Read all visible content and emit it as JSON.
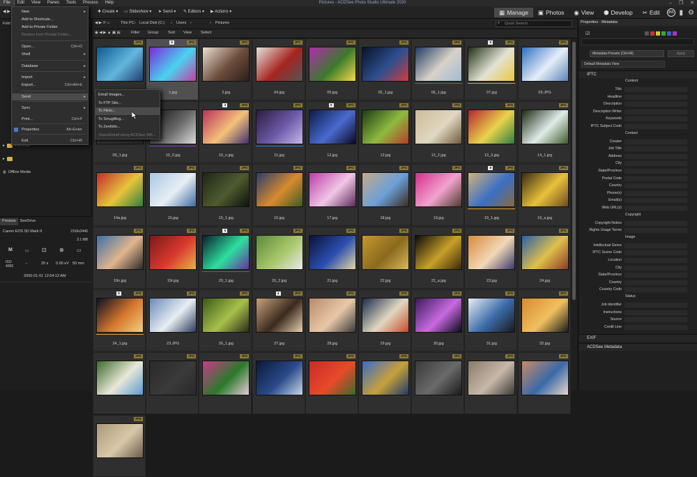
{
  "window": {
    "title": "Pictures - ACDSee Photo Studio Ultimate 2020",
    "controls": [
      "–",
      "❐",
      "✕"
    ]
  },
  "menubar": [
    "File",
    "Edit",
    "View",
    "Panes",
    "Tools",
    "Process",
    "Help"
  ],
  "toolbar": {
    "create": "Create",
    "slideshow": "Slideshow",
    "send": "Send",
    "editors": "Editors",
    "actions": "Actions"
  },
  "modes": {
    "manage": "Manage",
    "photos": "Photos",
    "view": "View",
    "develop": "Develop",
    "edit": "Edit",
    "badge": "365"
  },
  "file_menu": {
    "items": [
      {
        "label": "New",
        "shortcut": "",
        "arrow": "▸",
        "disabled": false
      },
      {
        "label": "Add to Shortcuts...",
        "shortcut": "",
        "arrow": "",
        "disabled": false
      },
      {
        "label": "Add to Private Folder",
        "shortcut": "",
        "arrow": "",
        "disabled": false
      },
      {
        "label": "Restore from Private Folder...",
        "shortcut": "",
        "arrow": "",
        "disabled": true
      },
      {
        "label": "Open...",
        "shortcut": "Ctrl+O",
        "arrow": "",
        "disabled": false
      },
      {
        "label": "Shell",
        "shortcut": "",
        "arrow": "▸",
        "disabled": false
      },
      {
        "label": "Database",
        "shortcut": "",
        "arrow": "▸",
        "disabled": false
      },
      {
        "label": "Import",
        "shortcut": "",
        "arrow": "▸",
        "disabled": false
      },
      {
        "label": "Export...",
        "shortcut": "Ctrl+Alt+E",
        "arrow": "",
        "disabled": false
      },
      {
        "label": "Send",
        "shortcut": "",
        "arrow": "▸",
        "disabled": false
      },
      {
        "label": "Sync",
        "shortcut": "",
        "arrow": "▸",
        "disabled": false
      },
      {
        "label": "Print...",
        "shortcut": "Ctrl+P",
        "arrow": "",
        "disabled": false
      },
      {
        "label": "Properties",
        "shortcut": "Alt+Enter",
        "arrow": "",
        "disabled": false
      },
      {
        "label": "Exit",
        "shortcut": "Ctrl+W",
        "arrow": "",
        "disabled": false
      }
    ]
  },
  "send_menu": {
    "items": [
      {
        "label": "Email Images...",
        "disabled": false
      },
      {
        "label": "To FTP Site...",
        "disabled": false
      },
      {
        "label": "To Flickr...",
        "disabled": false
      },
      {
        "label": "To SmugMug...",
        "disabled": false
      },
      {
        "label": "To Zenfolio...",
        "disabled": false
      },
      {
        "label": "Share/Email using ACDSee 365...",
        "disabled": true
      }
    ]
  },
  "tree": {
    "partial_label": "Fold",
    "favorites": "Favorites",
    "offline_media": "Offline Media"
  },
  "breadcrumb": [
    "This PC",
    "Local Disk (C:)",
    "Users",
    "Pictures"
  ],
  "quick_search": {
    "placeholder": "Quick Search"
  },
  "filterbar": [
    "Filter",
    "Group",
    "Sort",
    "View",
    "Select"
  ],
  "preview": {
    "tabs": [
      "Preview",
      "SeeDrive"
    ],
    "camera": "Canon EOS 5D Mark II",
    "dimensions": "2156x2446",
    "size": "3.1 MB",
    "mode": "M",
    "iso_label": "ISO",
    "iso_value": "4000",
    "dash1": "--",
    "shutter": "25 s",
    "ev": "0.00 eV",
    "focal": "50 mm",
    "datetime": "2000-01-01 12:54:12 AM"
  },
  "thumbnails": [
    {
      "name": "",
      "badge": "JPG",
      "num": "",
      "bar": "",
      "c": [
        "#0c5a8f",
        "#63b7de",
        "#1e3f6d"
      ]
    },
    {
      "name": "1.jpg",
      "badge": "JPG",
      "num": "5",
      "bar": "",
      "c": [
        "#7b2ad6",
        "#4ad3f0",
        "#c53ca2"
      ]
    },
    {
      "name": "2.jpg",
      "badge": "JPG",
      "num": "",
      "bar": "",
      "c": [
        "#eadfd1",
        "#6d4c3b",
        "#2b1f1a"
      ]
    },
    {
      "name": "04.jpg",
      "badge": "JPG",
      "num": "",
      "bar": "",
      "c": [
        "#e7e3dd",
        "#a5241e",
        "#555"
      ]
    },
    {
      "name": "05.jpg",
      "badge": "JPG",
      "num": "",
      "bar": "",
      "c": [
        "#b22bb0",
        "#3b7a2b",
        "#f6d94b"
      ]
    },
    {
      "name": "05_1.jpg",
      "badge": "JPG",
      "num": "",
      "bar": "",
      "c": [
        "#08142a",
        "#2f4f8f",
        "#d23a3a"
      ]
    },
    {
      "name": "06_1.jpg",
      "badge": "JPG",
      "num": "",
      "bar": "#1e8f4d",
      "c": [
        "#203a63",
        "#d8d2c8",
        "#9fbad6"
      ]
    },
    {
      "name": "07.jpg",
      "badge": "JPG",
      "num": "5",
      "bar": "#e0a42a",
      "c": [
        "#213018",
        "#e3e2d4",
        "#e9c840"
      ]
    },
    {
      "name": "09.JPG",
      "badge": "JPG",
      "num": "",
      "bar": "",
      "c": [
        "#2b6fc4",
        "#e6eef7",
        "#5b86b8"
      ]
    },
    {
      "name": "09_1.jpg",
      "badge": "JPG",
      "num": "",
      "bar": "",
      "c": [
        "#2f2f2f",
        "#3a3a3a",
        "#2f2f2f"
      ]
    },
    {
      "name": "10_0.jpg",
      "badge": "",
      "num": "",
      "bar": "#8a3dbf",
      "c": [
        "#0e0e0e",
        "#6a6a6a",
        "#dcdcdc"
      ]
    },
    {
      "name": "10_n.jpg",
      "badge": "JPG",
      "num": "4",
      "bar": "",
      "c": [
        "#b82f5a",
        "#f3c27a",
        "#3d2f6f"
      ]
    },
    {
      "name": "11.jpg",
      "badge": "JPG",
      "num": "",
      "bar": "#2c7dd0",
      "c": [
        "#2b1b3f",
        "#6c5aa8",
        "#c6b7e8"
      ]
    },
    {
      "name": "12.jpg",
      "badge": "JPG",
      "num": "5",
      "bar": "",
      "c": [
        "#0b1b45",
        "#4a6ad0",
        "#0a0a20"
      ]
    },
    {
      "name": "13.jpg",
      "badge": "JPG",
      "num": "",
      "bar": "",
      "c": [
        "#1f3a14",
        "#8dbb3e",
        "#b73a2a"
      ]
    },
    {
      "name": "13_2.jpg",
      "badge": "JPG",
      "num": "",
      "bar": "",
      "c": [
        "#cdbb97",
        "#e0d8c2",
        "#6f5a3b"
      ]
    },
    {
      "name": "13_3.jpg",
      "badge": "JPG",
      "num": "",
      "bar": "",
      "c": [
        "#b32530",
        "#e9d34b",
        "#2e7d43"
      ]
    },
    {
      "name": "14_1.jpg",
      "badge": "JPG",
      "num": "",
      "bar": "",
      "c": [
        "#1c2a16",
        "#e0ece8",
        "#3e5b2a"
      ]
    },
    {
      "name": "14a.jpg",
      "badge": "JPG",
      "num": "",
      "bar": "",
      "c": [
        "#c22b2b",
        "#e8c43b",
        "#2d7d3d"
      ]
    },
    {
      "name": "15.jpg",
      "badge": "JPG",
      "num": "",
      "bar": "",
      "c": [
        "#a9c8e6",
        "#e8eef4",
        "#3c6b9e"
      ]
    },
    {
      "name": "15_1.jpg",
      "badge": "JPG",
      "num": "",
      "bar": "",
      "c": [
        "#1c2617",
        "#4f5b2f",
        "#0e120c"
      ]
    },
    {
      "name": "16.jpg",
      "badge": "JPG",
      "num": "",
      "bar": "",
      "c": [
        "#2a3c6a",
        "#d88a2f",
        "#3d5a22"
      ]
    },
    {
      "name": "17.jpg",
      "badge": "JPG",
      "num": "",
      "bar": "",
      "c": [
        "#b83ea6",
        "#f0c6e6",
        "#5e2a5a"
      ]
    },
    {
      "name": "18.jpg",
      "badge": "JPG",
      "num": "",
      "bar": "",
      "c": [
        "#c7a98a",
        "#6aa0d8",
        "#3c2a1e"
      ]
    },
    {
      "name": "19.jpg",
      "badge": "JPG",
      "num": "",
      "bar": "",
      "c": [
        "#d32e8a",
        "#f2a3cf",
        "#4c3b2a"
      ]
    },
    {
      "name": "19_1.jpg",
      "badge": "JPG",
      "num": "5",
      "bar": "#e0a42a",
      "c": [
        "#d2b27e",
        "#3a6fc4",
        "#8a6a3e"
      ]
    },
    {
      "name": "19_a.jpg",
      "badge": "JPG",
      "num": "",
      "bar": "",
      "c": [
        "#3a2a14",
        "#e8c23a",
        "#6b4a22"
      ]
    },
    {
      "name": "19n.jpg",
      "badge": "JPG",
      "num": "",
      "bar": "",
      "c": [
        "#3c6ea8",
        "#e1b58c",
        "#2a2a2a"
      ]
    },
    {
      "name": "19r.jpg",
      "badge": "JPG",
      "num": "",
      "bar": "",
      "c": [
        "#7a1a1a",
        "#d8382e",
        "#e6b34a"
      ]
    },
    {
      "name": "20_1.jpg",
      "badge": "JPG",
      "num": "5",
      "bar": "#1e8f4d",
      "c": [
        "#0a1e2a",
        "#2de0a0",
        "#6a2fa0"
      ]
    },
    {
      "name": "20_2.jpg",
      "badge": "JPG",
      "num": "",
      "bar": "",
      "c": [
        "#5c8a3a",
        "#a8c76a",
        "#e9e9e9"
      ]
    },
    {
      "name": "21.jpg",
      "badge": "JPG",
      "num": "",
      "bar": "",
      "c": [
        "#0a1238",
        "#2c4fb0",
        "#e6d9a0"
      ]
    },
    {
      "name": "22.jpg",
      "badge": "JPG",
      "num": "",
      "bar": "",
      "c": [
        "#c7982e",
        "#8a6a1e",
        "#d9b85a"
      ]
    },
    {
      "name": "22_a.jpg",
      "badge": "JPG",
      "num": "",
      "bar": "",
      "c": [
        "#0a0a0a",
        "#c8a02a",
        "#3a2a0a"
      ]
    },
    {
      "name": "23.jpg",
      "badge": "JPG",
      "num": "",
      "bar": "",
      "c": [
        "#d88a3a",
        "#f2d8b8",
        "#3a3a6a"
      ]
    },
    {
      "name": "24.jpg",
      "badge": "JPG",
      "num": "",
      "bar": "",
      "c": [
        "#2a5fa8",
        "#e0c04a",
        "#8a3a2a"
      ]
    },
    {
      "name": "24_1.jpg",
      "badge": "JPG",
      "num": "5",
      "bar": "#e0a42a",
      "c": [
        "#0a0f22",
        "#d8782e",
        "#f0d080"
      ]
    },
    {
      "name": "23.JPG",
      "badge": "JPG",
      "num": "",
      "bar": "",
      "c": [
        "#6a8ab8",
        "#e8eef4",
        "#2a3a5a"
      ]
    },
    {
      "name": "26_1.jpg",
      "badge": "JPG",
      "num": "",
      "bar": "",
      "c": [
        "#3a5a1a",
        "#a8c04a",
        "#2a2a1a"
      ]
    },
    {
      "name": "27.jpg",
      "badge": "JPG",
      "num": "4",
      "bar": "",
      "c": [
        "#c8a27a",
        "#3a2a1e",
        "#e8d0b0"
      ]
    },
    {
      "name": "28.jpg",
      "badge": "JPG",
      "num": "",
      "bar": "",
      "c": [
        "#b88a6a",
        "#e8c8a8",
        "#3a3a3a"
      ]
    },
    {
      "name": "29.jpg",
      "badge": "JPG",
      "num": "",
      "bar": "",
      "c": [
        "#1a2a4a",
        "#e0d8c0",
        "#c84a2a"
      ]
    },
    {
      "name": "30.jpg",
      "badge": "JPG",
      "num": "",
      "bar": "",
      "c": [
        "#3a1a5a",
        "#c86ae0",
        "#0a0a1a"
      ]
    },
    {
      "name": "31.jpg",
      "badge": "JPG",
      "num": "",
      "bar": "",
      "c": [
        "#e8eef4",
        "#3a6aa8",
        "#1a1a1a"
      ]
    },
    {
      "name": "32.jpg",
      "badge": "JPG",
      "num": "",
      "bar": "",
      "c": [
        "#d88a2e",
        "#f0c060",
        "#1a1a1a"
      ]
    },
    {
      "name": "",
      "badge": "JPG",
      "num": "",
      "bar": "",
      "c": [
        "#3a6a2a",
        "#e8e8d8",
        "#5a9ad0"
      ]
    },
    {
      "name": "",
      "badge": "JPG",
      "num": "",
      "bar": "",
      "c": [
        "#2a2a2a",
        "#3a3a3a",
        "#2a2a2a"
      ]
    },
    {
      "name": "",
      "badge": "JPG",
      "num": "",
      "bar": "",
      "c": [
        "#c83a8a",
        "#2a7a2a",
        "#e8c8d8"
      ]
    },
    {
      "name": "",
      "badge": "JPG",
      "num": "",
      "bar": "",
      "c": [
        "#0a1a3a",
        "#2a4a8a",
        "#c8d8e8"
      ]
    },
    {
      "name": "",
      "badge": "JPG",
      "num": "",
      "bar": "",
      "c": [
        "#c82a2a",
        "#e84a2a",
        "#3a6a2a"
      ]
    },
    {
      "name": "",
      "badge": "JPG",
      "num": "",
      "bar": "",
      "c": [
        "#3a6ac8",
        "#c8a03a",
        "#1a3a6a"
      ]
    },
    {
      "name": "",
      "badge": "JPG",
      "num": "",
      "bar": "",
      "c": [
        "#3a3a3a",
        "#6a6a6a",
        "#1a1a1a"
      ]
    },
    {
      "name": "",
      "badge": "JPG",
      "num": "",
      "bar": "",
      "c": [
        "#8a7a6a",
        "#c8b8a8",
        "#3a3a3a"
      ]
    },
    {
      "name": "",
      "badge": "JPG",
      "num": "",
      "bar": "",
      "c": [
        "#c88a6a",
        "#3a6aa8",
        "#e8d8c8"
      ]
    },
    {
      "name": "",
      "badge": "JPG",
      "num": "",
      "bar": "",
      "c": [
        "#a89a7a",
        "#d8c8a8",
        "#6a5a4a"
      ]
    }
  ],
  "properties": {
    "title": "Properties - Metadata",
    "presets": "Metadata Presets (Ctrl+M)",
    "apply": "Apply",
    "view": "Default Metadata View",
    "iptc": "IPTC",
    "groups": {
      "content": "Content",
      "contact": "Contact",
      "copyright": "Copyright",
      "image": "Image",
      "status": "Status"
    },
    "content_fields": [
      "Title",
      "Headline",
      "Description",
      "Description Writer",
      "Keywords",
      "IPTC Subject Code"
    ],
    "contact_fields": [
      "Creator",
      "Job Title",
      "Address",
      "City",
      "State/Province",
      "Postal Code",
      "Country",
      "Phone(s)",
      "Email(s)",
      "Web URL(s)"
    ],
    "copyright_fields": [
      "Copyright Notice",
      "Rights Usage Terms"
    ],
    "image_fields": [
      "Intellectual Genre",
      "IPTC Scene Code",
      "Location",
      "City",
      "State/Province",
      "Country",
      "Country Code"
    ],
    "status_fields": [
      "Job Identifier",
      "Instructions",
      "Source",
      "Credit Line"
    ],
    "exif": "EXIF",
    "acdsee_metadata": "ACDSee Metadata"
  }
}
